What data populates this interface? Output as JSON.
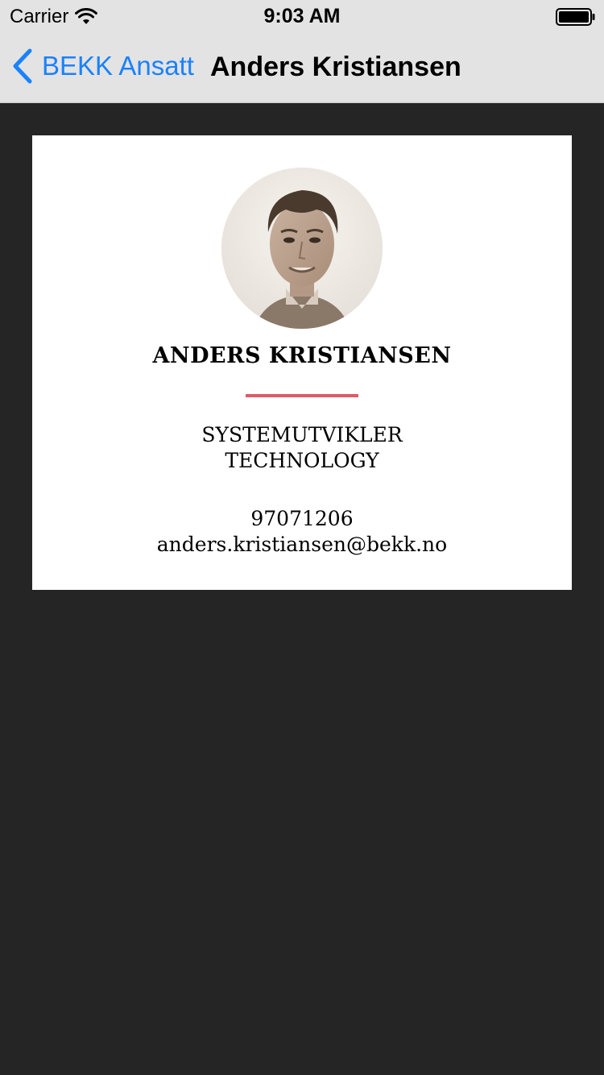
{
  "status_bar": {
    "carrier": "Carrier",
    "time": "9:03 AM",
    "wifi_icon": "wifi-icon",
    "battery_icon": "battery-full-icon"
  },
  "nav": {
    "back_label": "BEKK Ansatt",
    "back_icon": "chevron-left-icon",
    "title": "Anders Kristiansen",
    "accent_color": "#1a82fb"
  },
  "profile": {
    "name": "ANDERS KRISTIANSEN",
    "title": "SYSTEMUTVIKLER",
    "department": "TECHNOLOGY",
    "phone": "97071206",
    "email": "anders.kristiansen@bekk.no",
    "divider_color": "#e05a66"
  }
}
